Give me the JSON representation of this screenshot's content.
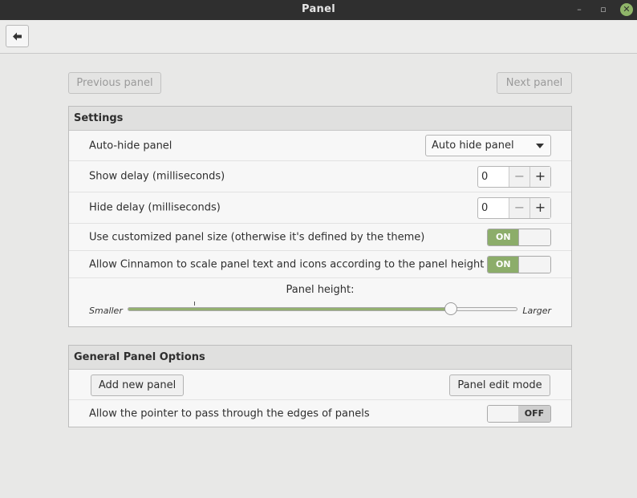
{
  "window": {
    "title": "Panel",
    "controls": {
      "minimize": "–",
      "maximize": "▫",
      "close": "✕"
    }
  },
  "toolbar": {
    "back_icon": "back-arrow-icon"
  },
  "nav": {
    "previous_label": "Previous panel",
    "next_label": "Next panel"
  },
  "settings": {
    "header": "Settings",
    "auto_hide": {
      "label": "Auto-hide panel",
      "value": "Auto hide panel"
    },
    "show_delay": {
      "label": "Show delay (milliseconds)",
      "value": "0"
    },
    "hide_delay": {
      "label": "Hide delay (milliseconds)",
      "value": "0"
    },
    "custom_size": {
      "label": "Use customized panel size (otherwise it's defined by the theme)",
      "state": "ON"
    },
    "scale_text": {
      "label": "Allow Cinnamon to scale panel text and icons according to the panel height",
      "state": "ON"
    },
    "panel_height": {
      "label": "Panel height:",
      "min_label": "Smaller",
      "max_label": "Larger",
      "fraction": 0.83
    }
  },
  "general": {
    "header": "General Panel Options",
    "add_panel_label": "Add new panel",
    "edit_mode_label": "Panel edit mode",
    "pass_through": {
      "label": "Allow the pointer to pass through the edges of panels",
      "state": "OFF"
    }
  },
  "colors": {
    "accent": "#8cad6a",
    "titlebar": "#2f2f2f",
    "background": "#e8e8e7"
  }
}
